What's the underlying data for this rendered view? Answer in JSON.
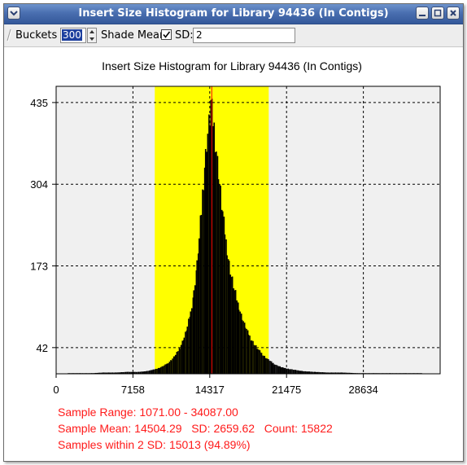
{
  "window": {
    "title": "Insert Size Histogram for Library 94436 (In Contigs)"
  },
  "toolbar": {
    "buckets_label": "Buckets",
    "buckets_value": "300",
    "shade_mean_label": "Shade Mean",
    "shade_mean_checked": true,
    "sd_label": "SD:",
    "sd_value": "2"
  },
  "chart_data": {
    "type": "bar",
    "title": "Insert Size Histogram for Library 94436 (In Contigs)",
    "xlabel": "",
    "ylabel": "",
    "x_ticks": [
      0,
      7158,
      14317,
      21475,
      28634
    ],
    "y_ticks": [
      42,
      173,
      304,
      435
    ],
    "xlim": [
      0,
      35791
    ],
    "ylim": [
      0,
      461
    ],
    "grid": true,
    "shade_range": [
      9194.67,
      19813.91
    ],
    "mean": 14504.29,
    "bins": [
      [
        1071,
        1
      ],
      [
        2171,
        1
      ],
      [
        3271,
        1
      ],
      [
        4371,
        2
      ],
      [
        5471,
        2
      ],
      [
        6571,
        3
      ],
      [
        7671,
        3
      ],
      [
        8271,
        4
      ],
      [
        8871,
        6
      ],
      [
        9471,
        9
      ],
      [
        9871,
        12
      ],
      [
        10271,
        16
      ],
      [
        10671,
        22
      ],
      [
        11071,
        30
      ],
      [
        11471,
        42
      ],
      [
        11871,
        58
      ],
      [
        12171,
        75
      ],
      [
        12471,
        98
      ],
      [
        12771,
        130
      ],
      [
        13071,
        175
      ],
      [
        13271,
        215
      ],
      [
        13471,
        260
      ],
      [
        13671,
        310
      ],
      [
        13871,
        350
      ],
      [
        14071,
        385
      ],
      [
        14271,
        410
      ],
      [
        14371,
        435
      ],
      [
        14471,
        420
      ],
      [
        14671,
        395
      ],
      [
        14871,
        360
      ],
      [
        15071,
        325
      ],
      [
        15271,
        290
      ],
      [
        15471,
        258
      ],
      [
        15671,
        228
      ],
      [
        15871,
        200
      ],
      [
        16071,
        176
      ],
      [
        16371,
        150
      ],
      [
        16671,
        128
      ],
      [
        16971,
        108
      ],
      [
        17271,
        90
      ],
      [
        17571,
        76
      ],
      [
        17871,
        64
      ],
      [
        18171,
        54
      ],
      [
        18571,
        44
      ],
      [
        18971,
        35
      ],
      [
        19371,
        28
      ],
      [
        19771,
        22
      ],
      [
        20171,
        17
      ],
      [
        20571,
        13
      ],
      [
        21071,
        10
      ],
      [
        21571,
        8
      ],
      [
        22271,
        6
      ],
      [
        23071,
        4
      ],
      [
        24071,
        3
      ],
      [
        25271,
        2
      ],
      [
        26571,
        2
      ],
      [
        28071,
        1
      ],
      [
        29571,
        1
      ],
      [
        31071,
        1
      ],
      [
        32571,
        1
      ],
      [
        34087,
        1
      ]
    ]
  },
  "stats": {
    "line1": "Sample Range: 1071.00 - 34087.00",
    "line2": "Sample Mean: 14504.29   SD: 2659.62   Count: 15822",
    "line3": "Samples within 2 SD: 15013 (94.89%)"
  },
  "colors": {
    "shade": "#ffff00",
    "bars": "#000000",
    "mean_line": "#ff0000",
    "plot_bg": "#f0f0f0",
    "stats_text": "#ff1a1a",
    "titlebar": "#4a6fb0"
  }
}
